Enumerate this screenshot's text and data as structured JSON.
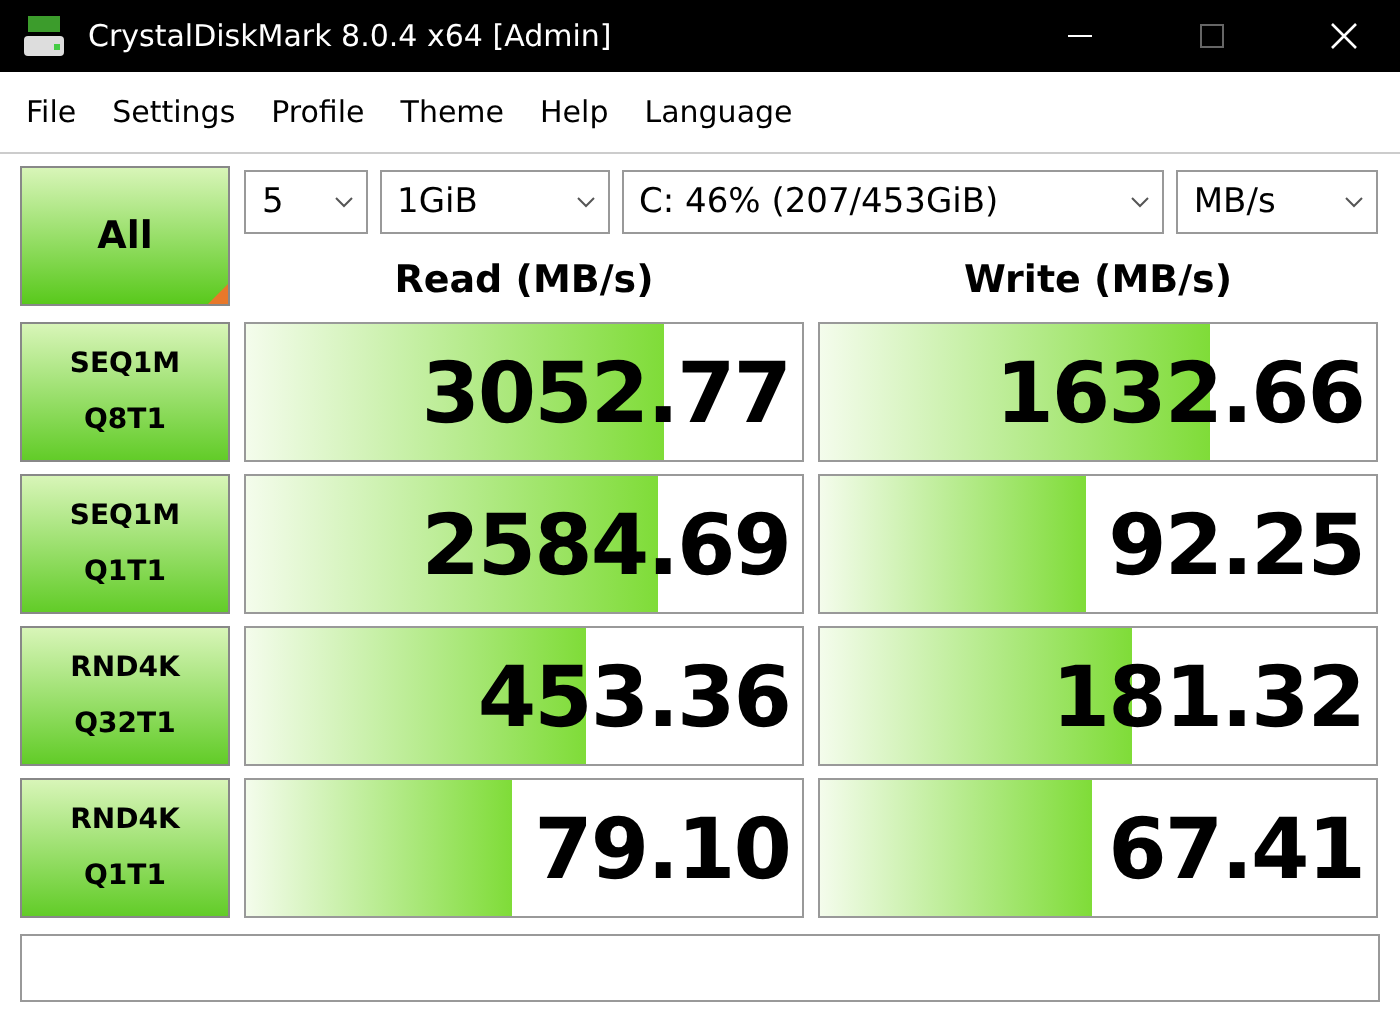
{
  "window": {
    "title": "CrystalDiskMark 8.0.4 x64 [Admin]"
  },
  "menu": [
    "File",
    "Settings",
    "Profile",
    "Theme",
    "Help",
    "Language"
  ],
  "all_button": "All",
  "selectors": [
    {
      "value": "5"
    },
    {
      "value": "1GiB"
    },
    {
      "value": "C: 46% (207/453GiB)"
    },
    {
      "value": "MB/s"
    }
  ],
  "headers": [
    "Read (MB/s)",
    "Write (MB/s)"
  ],
  "tests": [
    {
      "line1": "SEQ1M",
      "line2": "Q8T1",
      "read": {
        "value": "3052.77",
        "level": 0.75
      },
      "write": {
        "value": "1632.66",
        "level": 0.7
      }
    },
    {
      "line1": "SEQ1M",
      "line2": "Q1T1",
      "read": {
        "value": "2584.69",
        "level": 0.74
      },
      "write": {
        "value": "92.25",
        "level": 0.48
      }
    },
    {
      "line1": "RND4K",
      "line2": "Q32T1",
      "read": {
        "value": "453.36",
        "level": 0.61
      },
      "write": {
        "value": "181.32",
        "level": 0.56
      }
    },
    {
      "line1": "RND4K",
      "line2": "Q1T1",
      "read": {
        "value": "79.10",
        "level": 0.48
      },
      "write": {
        "value": "67.41",
        "level": 0.49
      }
    }
  ]
}
